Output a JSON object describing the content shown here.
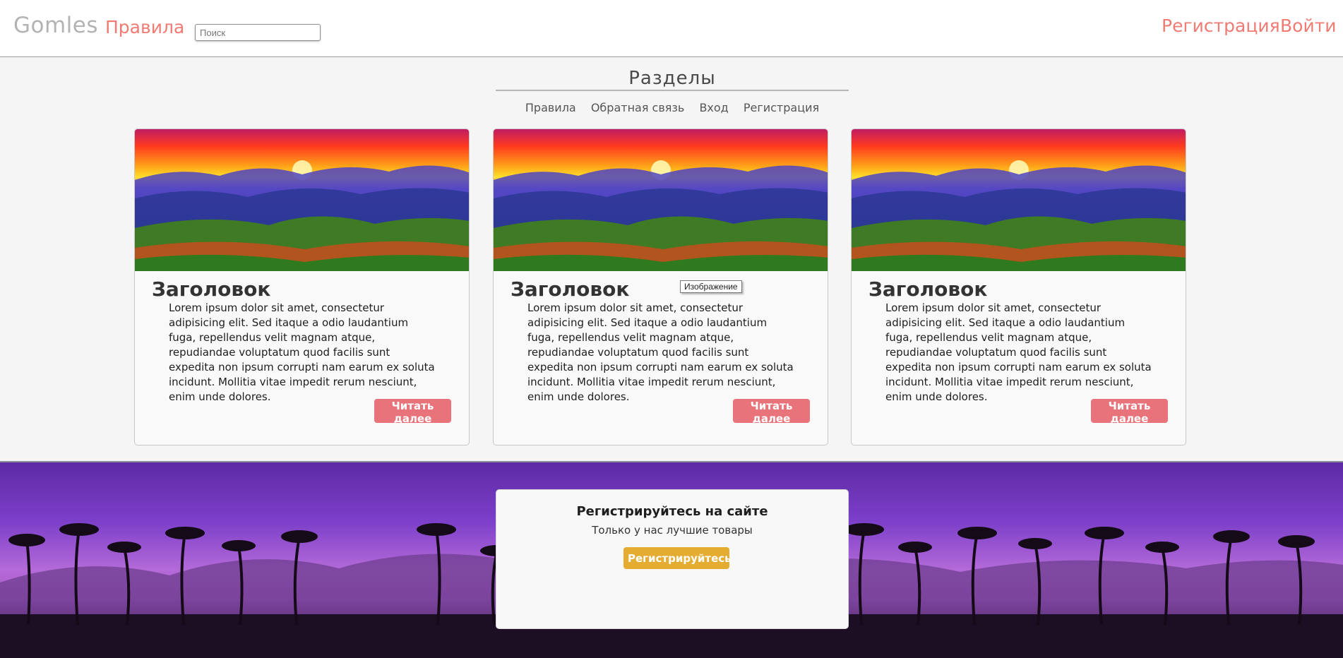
{
  "header": {
    "logo": "Gomles",
    "rules_link": "Правила",
    "search_placeholder": "Поиск",
    "register_link": "Регистрация",
    "login_link": "Войти"
  },
  "sections": {
    "title": "Разделы",
    "links": [
      "Правила",
      "Обратная связь",
      "Вход",
      "Регистрация"
    ]
  },
  "cards": [
    {
      "title": "Заголовок",
      "text": "Lorem ipsum dolor sit amet, consectetur adipisicing elit. Sed itaque a odio laudantium fuga, repellendus velit magnam atque, repudiandae voluptatum quod facilis sunt expedita non ipsum corrupti nam earum ex soluta incidunt. Mollitia vitae impedit rerum nesciunt, enim unde dolores.",
      "button": "Читать далее"
    },
    {
      "title": "Заголовок",
      "text": "Lorem ipsum dolor sit amet, consectetur adipisicing elit. Sed itaque a odio laudantium fuga, repellendus velit magnam atque, repudiandae voluptatum quod facilis sunt expedita non ipsum corrupti nam earum ex soluta incidunt. Mollitia vitae impedit rerum nesciunt, enim unde dolores.",
      "button": "Читать далее"
    },
    {
      "title": "Заголовок",
      "text": "Lorem ipsum dolor sit amet, consectetur adipisicing elit. Sed itaque a odio laudantium fuga, repellendus velit magnam atque, repudiandae voluptatum quod facilis sunt expedita non ipsum corrupti nam earum ex soluta incidunt. Mollitia vitae impedit rerum nesciunt, enim unde dolores.",
      "button": "Читать далее"
    }
  ],
  "tooltip": "Изображение",
  "promo": {
    "title": "Регистрируйтесь на сайте",
    "subtitle": "Только у нас лучшие товары",
    "button": "Регистрируйтесь"
  },
  "colors": {
    "accent": "#ef7b73",
    "read_more_button": "#e9737a",
    "register_button": "#e5ac32"
  }
}
